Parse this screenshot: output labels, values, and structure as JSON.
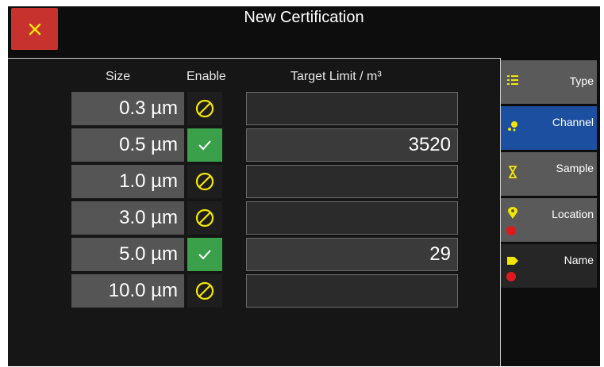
{
  "window": {
    "title": "New Certification",
    "close_icon": "close-icon"
  },
  "table": {
    "headers": {
      "size": "Size",
      "enable": "Enable",
      "target": "Target Limit / m³"
    },
    "rows": [
      {
        "size": "0.3 µm",
        "enabled": false,
        "target": ""
      },
      {
        "size": "0.5 µm",
        "enabled": true,
        "target": "3520"
      },
      {
        "size": "1.0 µm",
        "enabled": false,
        "target": ""
      },
      {
        "size": "3.0 µm",
        "enabled": false,
        "target": ""
      },
      {
        "size": "5.0 µm",
        "enabled": true,
        "target": "29"
      },
      {
        "size": "10.0 µm",
        "enabled": false,
        "target": ""
      }
    ]
  },
  "sidebar": {
    "items": [
      {
        "label": "Type",
        "icon": "list-icon",
        "active": false,
        "warning": false
      },
      {
        "label": "Channel",
        "icon": "dots-icon",
        "active": true,
        "warning": false
      },
      {
        "label": "Sample",
        "icon": "hourglass-icon",
        "active": false,
        "warning": false
      },
      {
        "label": "Location",
        "icon": "pin-icon",
        "active": false,
        "warning": true
      },
      {
        "label": "Name",
        "icon": "tag-icon",
        "active": false,
        "warning": true
      }
    ]
  },
  "colors": {
    "accent_yellow": "#f5e600",
    "close_red": "#c8322e",
    "enabled_green": "#3aa14a",
    "active_blue": "#1d4fa0",
    "warning_red": "#e01a1a"
  }
}
